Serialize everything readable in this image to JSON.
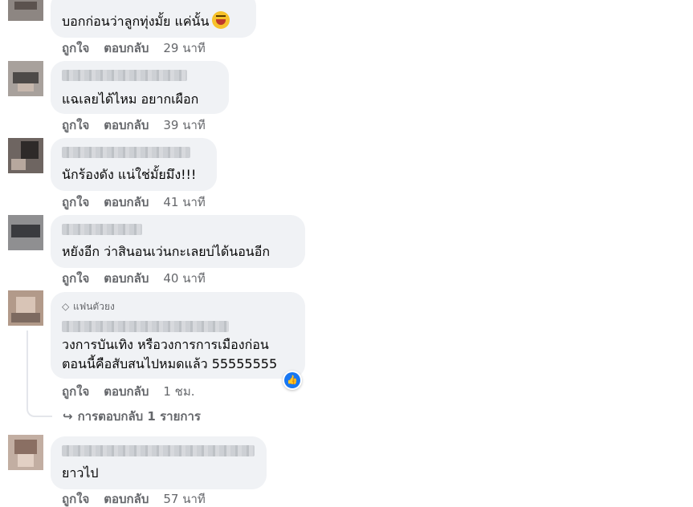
{
  "colors": {
    "bubble_bg": "#f0f2f5",
    "meta_text": "#65676b",
    "like_blue": "#1877f2"
  },
  "comments": [
    {
      "text": "บอกก่อนว่าลูกทุ่งมั้ย แค่นั้น",
      "emoji": "laughing-face",
      "like": "ถูกใจ",
      "reply": "ตอบกลับ",
      "time": "29 นาที"
    },
    {
      "text": "แฉเลยได้ไหม อยากเผือก",
      "like": "ถูกใจ",
      "reply": "ตอบกลับ",
      "time": "39 นาที"
    },
    {
      "text": "นักร้องดัง แน่ใช่มั้ยมึง!!!",
      "like": "ถูกใจ",
      "reply": "ตอบกลับ",
      "time": "41 นาที"
    },
    {
      "text": "หยังอีก ว่าสินอนเว่นกะเลยบ่ได้นอนอีก",
      "like": "ถูกใจ",
      "reply": "ตอบกลับ",
      "time": "40 นาที"
    },
    {
      "badge": "แฟนตัวยง",
      "badge_icon": "diamond-icon",
      "text_line1": "วงการบันเทิง หรือวงการการเมืองก่อน",
      "text_line2": "ตอนนี้คือสับสนไปหมดแล้ว 55555555",
      "reaction_icon": "like-icon",
      "like": "ถูกใจ",
      "reply": "ตอบกลับ",
      "time": "1 ชม.",
      "replies_link": "การตอบกลับ 1 รายการ"
    },
    {
      "text": "ยาวไป",
      "like": "ถูกใจ",
      "reply": "ตอบกลับ",
      "time": "57 นาที"
    }
  ]
}
